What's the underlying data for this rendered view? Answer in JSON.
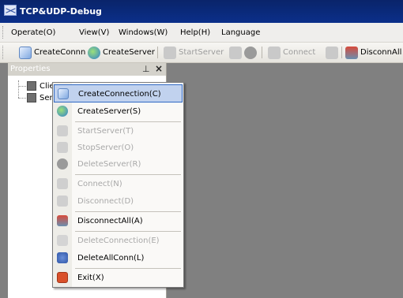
{
  "window": {
    "title": "TCP&UDP-Debug",
    "app_icon": "network-icon"
  },
  "menubar": {
    "items": [
      "Operate(O)",
      "View(V)",
      "Windows(W)",
      "Help(H)",
      "Language"
    ]
  },
  "toolbar": {
    "create_connection": "CreateConnn",
    "create_server": "CreateServer",
    "start_server": "StartServer",
    "connect": "Connect",
    "disconnect_all": "DisconnAll"
  },
  "panel": {
    "title": "Properties",
    "pin": "ꟷ",
    "close": "×",
    "nodes": [
      "Client Mode",
      "Server Mode"
    ]
  },
  "context_menu": {
    "items": [
      {
        "label": "CreateConnection(C)",
        "state": "highlighted",
        "icon": "create-connection-icon"
      },
      {
        "label": "CreateServer(S)",
        "state": "enabled",
        "icon": "create-server-icon"
      },
      {
        "label": "StartServer(T)",
        "state": "disabled",
        "icon": "start-server-icon"
      },
      {
        "label": "StopServer(O)",
        "state": "disabled",
        "icon": "stop-server-icon"
      },
      {
        "label": "DeleteServer(R)",
        "state": "disabled",
        "icon": "delete-server-icon"
      },
      {
        "label": "Connect(N)",
        "state": "disabled",
        "icon": "connect-icon"
      },
      {
        "label": "Disconnect(D)",
        "state": "disabled",
        "icon": "disconnect-icon"
      },
      {
        "label": "DisconnectAll(A)",
        "state": "enabled",
        "icon": "disconnect-all-icon"
      },
      {
        "label": "DeleteConnection(E)",
        "state": "disabled",
        "icon": "delete-connection-icon"
      },
      {
        "label": "DeleteAllConn(L)",
        "state": "enabled",
        "icon": "delete-all-connections-icon"
      },
      {
        "label": "Exit(X)",
        "state": "enabled",
        "icon": "exit-icon"
      }
    ]
  },
  "colors": {
    "title_bar": "#0a246a",
    "highlight": "#c1d2ee",
    "highlight_border": "#316ac5",
    "workspace": "#808080",
    "disabled_text": "#a8a8a8"
  }
}
